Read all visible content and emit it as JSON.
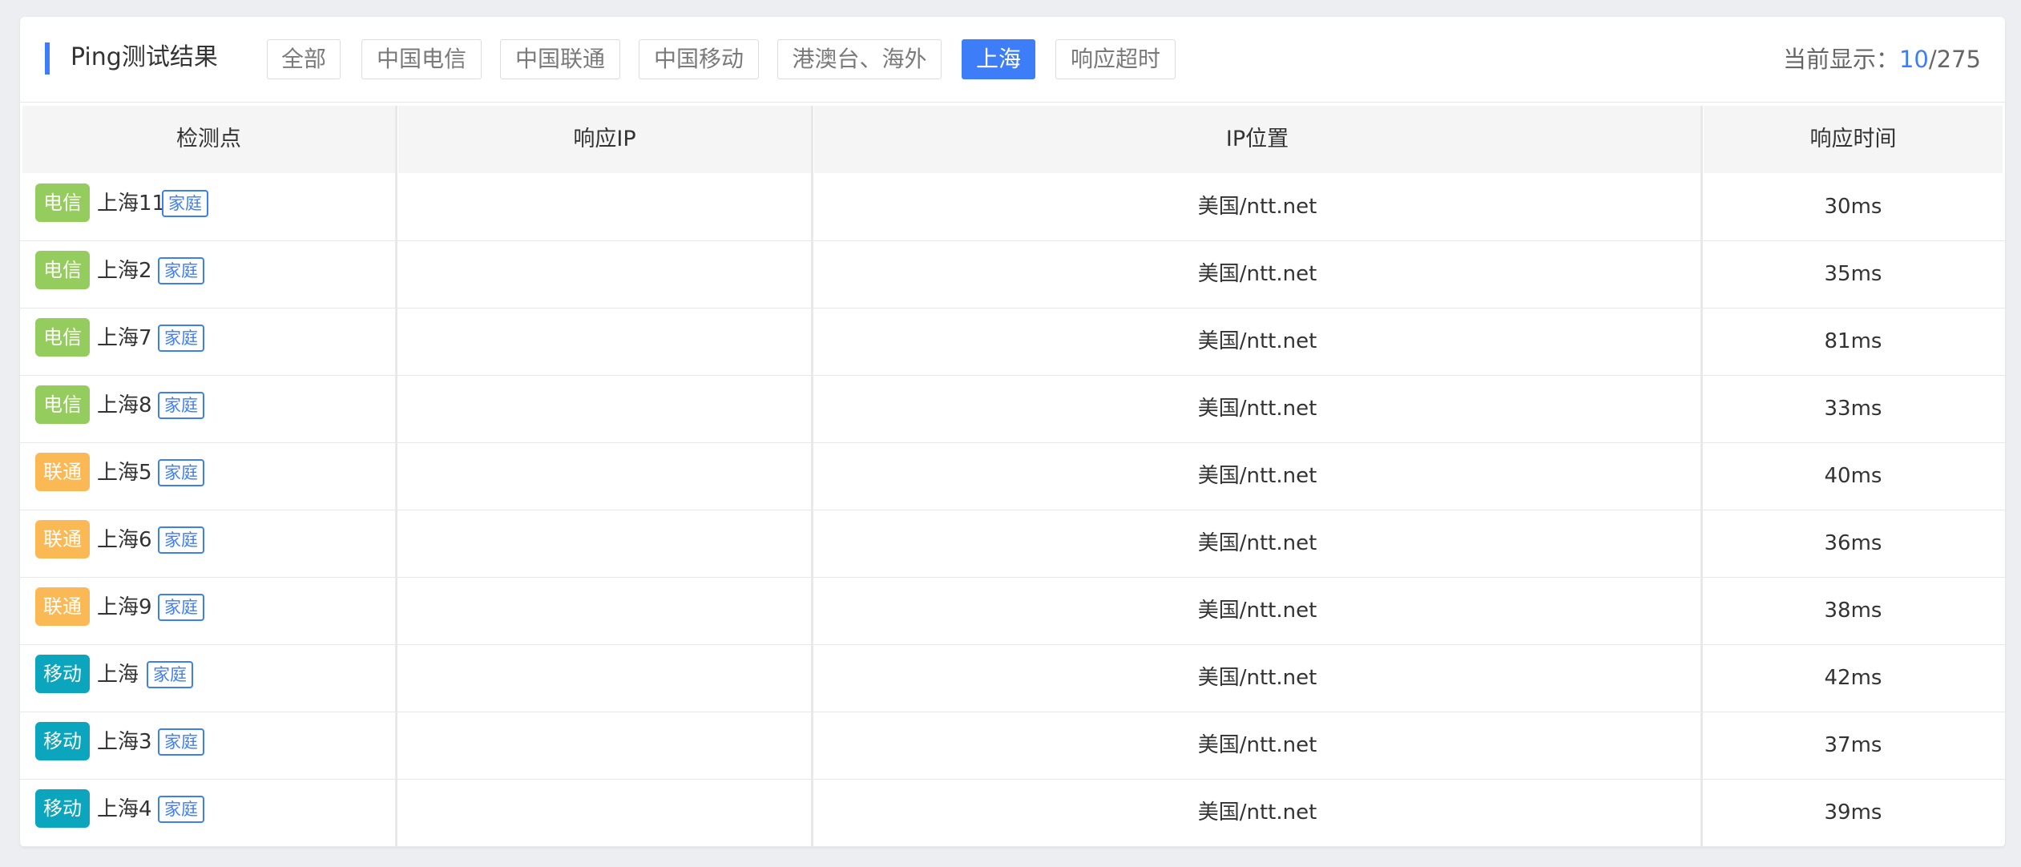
{
  "header": {
    "title": "Ping测试结果",
    "tabs": [
      "全部",
      "中国电信",
      "中国联通",
      "中国移动",
      "港澳台、海外",
      "上海",
      "响应超时"
    ],
    "active_tab": "上海",
    "count_label": "当前显示：",
    "count_current": "10",
    "count_total": "/275"
  },
  "table": {
    "columns": [
      "检测点",
      "响应IP",
      "IP位置",
      "响应时间"
    ],
    "rows": [
      {
        "isp": "电信",
        "node": "上海11",
        "tag": "家庭",
        "ip": "",
        "location": "美国/ntt.net",
        "time": "30ms"
      },
      {
        "isp": "电信",
        "node": "上海2",
        "tag": "家庭",
        "ip": "",
        "location": "美国/ntt.net",
        "time": "35ms"
      },
      {
        "isp": "电信",
        "node": "上海7",
        "tag": "家庭",
        "ip": "",
        "location": "美国/ntt.net",
        "time": "81ms"
      },
      {
        "isp": "电信",
        "node": "上海8",
        "tag": "家庭",
        "ip": "",
        "location": "美国/ntt.net",
        "time": "33ms"
      },
      {
        "isp": "联通",
        "node": "上海5",
        "tag": "家庭",
        "ip": "",
        "location": "美国/ntt.net",
        "time": "40ms"
      },
      {
        "isp": "联通",
        "node": "上海6",
        "tag": "家庭",
        "ip": "",
        "location": "美国/ntt.net",
        "time": "36ms"
      },
      {
        "isp": "联通",
        "node": "上海9",
        "tag": "家庭",
        "ip": "",
        "location": "美国/ntt.net",
        "time": "38ms"
      },
      {
        "isp": "移动",
        "node": "上海",
        "tag": "家庭",
        "ip": "",
        "location": "美国/ntt.net",
        "time": "42ms"
      },
      {
        "isp": "移动",
        "node": "上海3",
        "tag": "家庭",
        "ip": "",
        "location": "美国/ntt.net",
        "time": "37ms"
      },
      {
        "isp": "移动",
        "node": "上海4",
        "tag": "家庭",
        "ip": "",
        "location": "美国/ntt.net",
        "time": "39ms"
      }
    ]
  },
  "colors": {
    "accent": "#3d7ef8",
    "isp_telecom": "#95cc5e",
    "isp_unicom": "#fbb956",
    "isp_mobile": "#0ba5be"
  }
}
